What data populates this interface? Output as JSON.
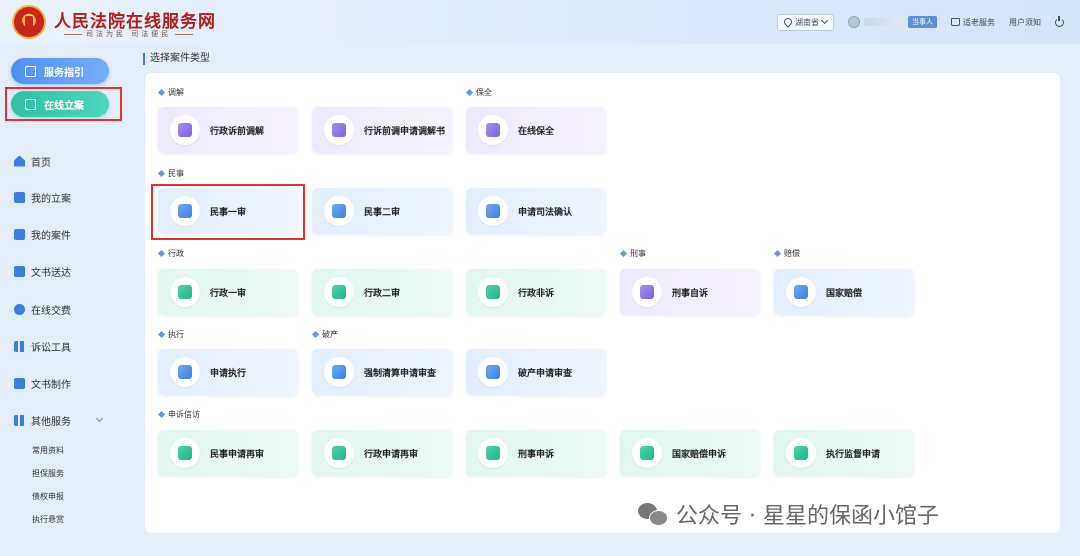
{
  "header": {
    "site_title": "人民法院在线服务网",
    "slogan": "司法为民  司法便民",
    "region": "湖南省",
    "role_badge": "当事人",
    "link_elderly": "适老服务",
    "link_notice": "用户须知"
  },
  "sidebar": {
    "guide_button": "服务指引",
    "filing_button": "在线立案",
    "items": [
      {
        "label": "首页",
        "icon": "home-icon"
      },
      {
        "label": "我的立案",
        "icon": "edit-icon"
      },
      {
        "label": "我的案件",
        "icon": "folder-icon"
      },
      {
        "label": "文书送达",
        "icon": "mail-icon"
      },
      {
        "label": "在线交费",
        "icon": "coin-icon"
      },
      {
        "label": "诉讼工具",
        "icon": "tools-icon"
      },
      {
        "label": "文书制作",
        "icon": "document-icon"
      },
      {
        "label": "其他服务",
        "icon": "grid-icon"
      }
    ],
    "sub_items": [
      "常用资料",
      "担保服务",
      "债权申报",
      "执行悬赏"
    ]
  },
  "main": {
    "title": "选择案件类型",
    "sections": {
      "mediation": "调解",
      "preservation": "保全",
      "civil": "民事",
      "administrative": "行政",
      "criminal": "刑事",
      "compensation": "赔偿",
      "execution": "执行",
      "bankruptcy": "破产",
      "petition": "申诉信访"
    },
    "cards": {
      "admin_pre_mediation": "行政诉前调解",
      "admin_pre_mediation_book": "行诉前调申请调解书",
      "online_preservation": "在线保全",
      "civil_first": "民事一审",
      "civil_second": "民事二审",
      "judicial_confirm": "申请司法确认",
      "admin_first": "行政一审",
      "admin_second": "行政二审",
      "admin_non_litigation": "行政非诉",
      "criminal_private": "刑事自诉",
      "state_compensation": "国家赔偿",
      "apply_execution": "申请执行",
      "forced_liquidation": "强制清算申请审查",
      "bankruptcy_review": "破产申请审查",
      "civil_retrial": "民事申请再审",
      "admin_retrial": "行政申请再审",
      "criminal_appeal": "刑事申诉",
      "state_comp_appeal": "国家赔偿申诉",
      "execution_supervision": "执行监督申请"
    }
  },
  "watermark": "公众号 · 星星的保函小馆子"
}
